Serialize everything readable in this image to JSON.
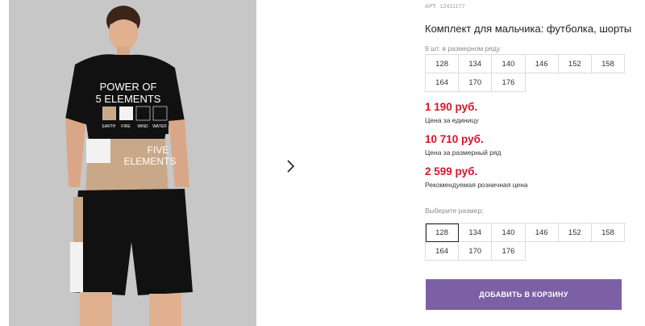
{
  "product": {
    "article_label": "АРТ.",
    "article_number": "12411177",
    "title": "Комплект для мальчика: футболка, шорты",
    "pack_note": "9 шт. в размерном ряду",
    "pack_sizes": [
      "128",
      "134",
      "140",
      "146",
      "152",
      "158",
      "164",
      "170",
      "176"
    ]
  },
  "photo": {
    "shirt_text_line1": "POWER OF",
    "shirt_text_line2": "5 ELEMENTS",
    "element_labels": [
      "EARTH",
      "FIRE",
      "WIND",
      "WATER"
    ],
    "shirt_text_line3": "FIVE",
    "shirt_text_line4": "ELEMENTS"
  },
  "prices": {
    "unit_price": "1 190 руб.",
    "unit_label": "Цена за единицу",
    "pack_price": "10 710 руб.",
    "pack_label": "Цена за размерный ряд",
    "retail_price": "2 599 руб.",
    "retail_label": "Рекомендуемая розничная цена",
    "price_color": "#d7132b"
  },
  "size_picker": {
    "label": "Выберите размер:",
    "selected": "128",
    "sizes": [
      "128",
      "134",
      "140",
      "146",
      "152",
      "158",
      "164",
      "170",
      "176"
    ]
  },
  "actions": {
    "add_to_cart": "ДОБАВИТЬ В КОРЗИНУ",
    "button_color": "#7b60a5"
  },
  "icons": {
    "next": "chevron-right-icon"
  }
}
